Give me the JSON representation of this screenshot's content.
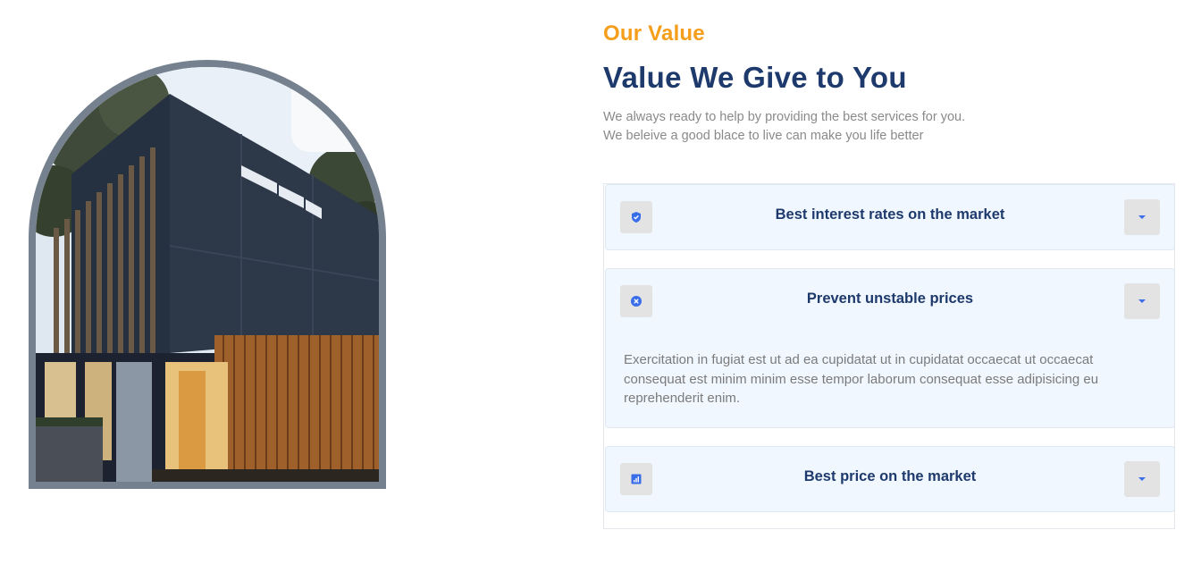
{
  "section": {
    "subtitle": "Our Value",
    "heading": "Value We Give to You",
    "description_lines": [
      "We always ready to help by providing the best services for you.",
      "We beleive a good blace to live can make you life better"
    ]
  },
  "image": {
    "subject": "modern house photo in arch frame"
  },
  "accordion": {
    "items": [
      {
        "icon": "shield-check-icon",
        "title": "Best interest rates on the market",
        "expanded": false,
        "body": ""
      },
      {
        "icon": "x-circle-icon",
        "title": "Prevent unstable prices",
        "expanded": true,
        "body": "Exercitation in fugiat est ut ad ea cupidatat ut in cupidatat occaecat ut occaecat consequat est minim minim esse tempor laborum consequat esse adipisicing eu reprehenderit enim."
      },
      {
        "icon": "bar-chart-icon",
        "title": "Best price on the market",
        "expanded": false,
        "body": ""
      }
    ]
  },
  "colors": {
    "accent_orange": "#f59e1b",
    "heading_navy": "#1e3a6d",
    "icon_blue": "#3a6ee8",
    "panel_bg": "#f0f7ff"
  }
}
